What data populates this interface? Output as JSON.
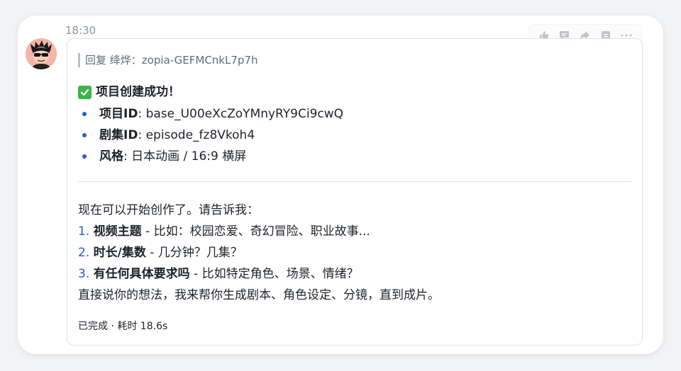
{
  "message": {
    "timestamp": "18:30",
    "reply_to": "回复 绛烨：zopia-GEFMCnkL7p7h",
    "success_title": "项目创建成功！",
    "info_items": [
      {
        "label": "项目ID",
        "value": ": base_U00eXcZoYMnyRY9Ci9cwQ"
      },
      {
        "label": "剧集ID",
        "value": ": episode_fz8Vkoh4"
      },
      {
        "label": "风格",
        "value": ": 日本动画 / 16:9 横屏"
      }
    ],
    "intro": "现在可以开始创作了。请告诉我：",
    "questions": [
      {
        "num": "1.",
        "title": "视频主题",
        "desc": " - 比如：校园恋爱、奇幻冒险、职业故事..."
      },
      {
        "num": "2.",
        "title": "时长/集数",
        "desc": " - 几分钟？几集？"
      },
      {
        "num": "3.",
        "title": "有任何具体要求吗",
        "desc": " - 比如特定角色、场景、情绪？"
      }
    ],
    "closing": "直接说你的想法，我来帮你生成剧本、角色设定、分镜，直到成片。",
    "status": "已完成 · 耗时 18.6s"
  },
  "actions": [
    "thumbs-up-icon",
    "comment-icon",
    "forward-icon",
    "save-icon",
    "more-icon"
  ],
  "colors": {
    "accent": "#245bdb",
    "check_green": "#3cb44b",
    "avatar_bg": "#f5b5a8"
  }
}
